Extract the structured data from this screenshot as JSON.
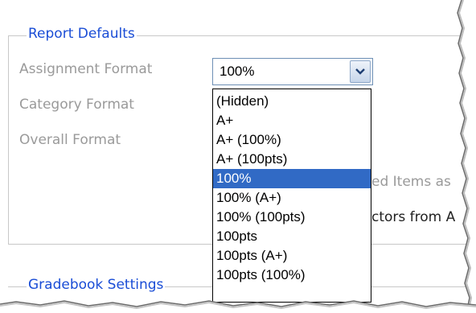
{
  "report_defaults": {
    "legend": "Report Defaults",
    "assignment_format_label": "Assignment Format",
    "category_format_label": "Category Format",
    "overall_format_label": "Overall Format",
    "hidden_text_1": "ed Items as",
    "hidden_text_2": "ctors from A"
  },
  "gradebook_settings": {
    "legend": "Gradebook Settings"
  },
  "assignment_format_select": {
    "selected_value": "100%",
    "options": [
      "(Hidden)",
      "A+",
      "A+ (100%)",
      "A+ (100pts)",
      "100%",
      "100% (A+)",
      "100% (100pts)",
      "100pts",
      "100pts (A+)",
      "100pts (100%)"
    ],
    "highlighted_option": "100%"
  },
  "colors": {
    "legend": "#1a4dd6",
    "label": "#9a9a9a",
    "highlight": "#316ac5",
    "select_border": "#6d8fb5"
  }
}
